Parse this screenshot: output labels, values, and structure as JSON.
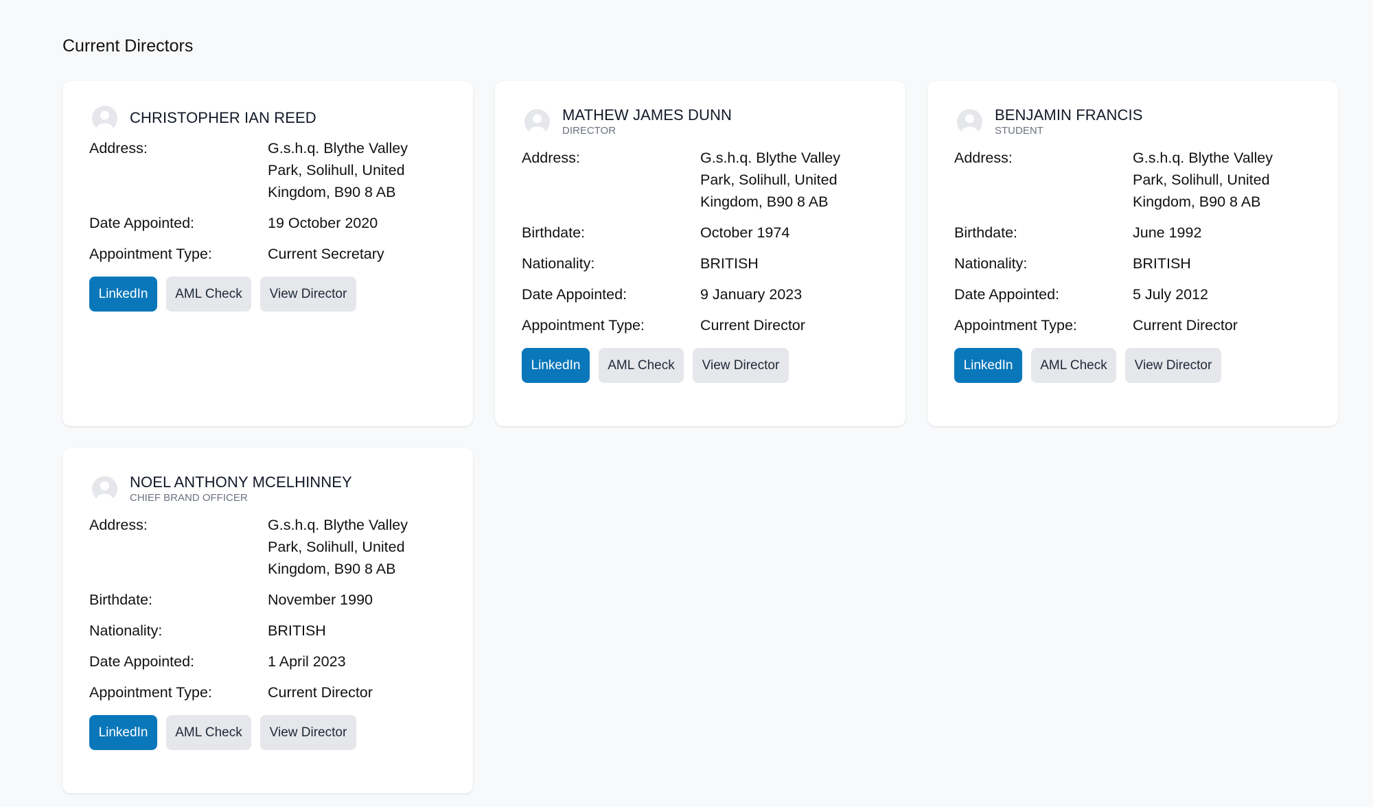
{
  "page": {
    "title": "Current Directors"
  },
  "labels": {
    "address": "Address:",
    "birthdate": "Birthdate:",
    "nationality": "Nationality:",
    "date_appointed": "Date Appointed:",
    "appointment_type": "Appointment Type:"
  },
  "buttons": {
    "linkedin": "LinkedIn",
    "aml_check": "AML Check",
    "view_director": "View Director"
  },
  "colors": {
    "primary": "#0a77ba",
    "secondary": "#e5e7eb",
    "background": "#f8f9fa"
  },
  "directors": [
    {
      "name": "CHRISTOPHER IAN REED",
      "role": "",
      "address": "G.s.h.q. Blythe Valley Park, Solihull, United Kingdom, B90 8 AB",
      "date_appointed": "19 October 2020",
      "appointment_type": "Current Secretary"
    },
    {
      "name": "MATHEW JAMES DUNN",
      "role": "DIRECTOR",
      "address": "G.s.h.q. Blythe Valley Park, Solihull, United Kingdom, B90 8 AB",
      "birthdate": "October 1974",
      "nationality": "BRITISH",
      "date_appointed": "9 January 2023",
      "appointment_type": "Current Director"
    },
    {
      "name": "BENJAMIN FRANCIS",
      "role": "STUDENT",
      "address": "G.s.h.q. Blythe Valley Park, Solihull, United Kingdom, B90 8 AB",
      "birthdate": "June 1992",
      "nationality": "BRITISH",
      "date_appointed": "5 July 2012",
      "appointment_type": "Current Director"
    },
    {
      "name": "NOEL ANTHONY MCELHINNEY",
      "role": "CHIEF BRAND OFFICER",
      "address": "G.s.h.q. Blythe Valley Park, Solihull, United Kingdom, B90 8 AB",
      "birthdate": "November 1990",
      "nationality": "BRITISH",
      "date_appointed": "1 April 2023",
      "appointment_type": "Current Director"
    }
  ]
}
